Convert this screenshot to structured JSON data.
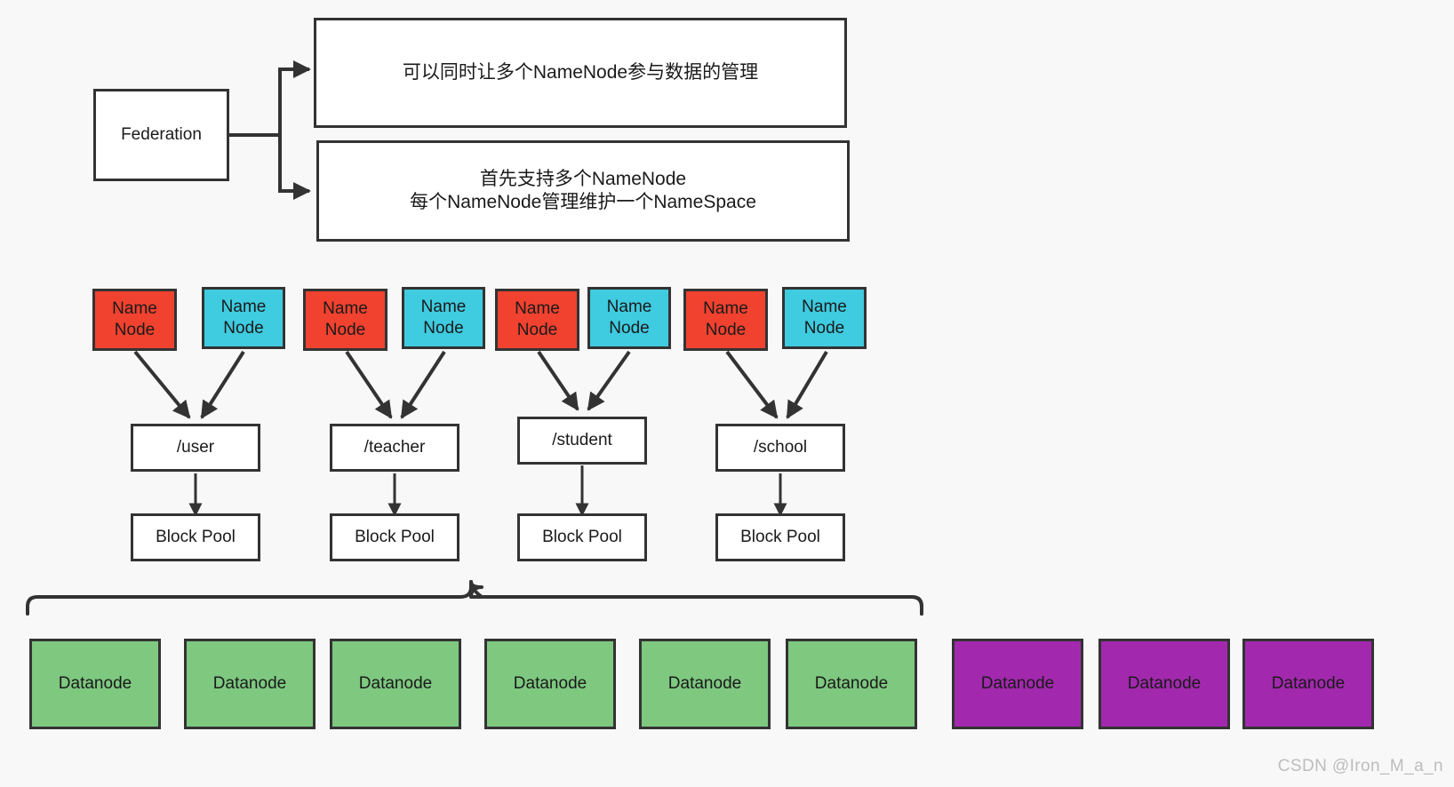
{
  "diagram": {
    "title_box": {
      "label": "Federation"
    },
    "info_boxes": [
      {
        "label": "可以同时让多个NameNode参与数据的管理"
      },
      {
        "label": "首先支持多个NameNode\n每个NameNode管理维护一个NameSpace"
      }
    ],
    "namenodes": [
      {
        "label": "Name\nNode",
        "color": "#f0422f",
        "kind": "red"
      },
      {
        "label": "Name\nNode",
        "color": "#3fcbe0",
        "kind": "cyan"
      },
      {
        "label": "Name\nNode",
        "color": "#f0422f",
        "kind": "red"
      },
      {
        "label": "Name\nNode",
        "color": "#3fcbe0",
        "kind": "cyan"
      },
      {
        "label": "Name\nNode",
        "color": "#f0422f",
        "kind": "red"
      },
      {
        "label": "Name\nNode",
        "color": "#3fcbe0",
        "kind": "cyan"
      },
      {
        "label": "Name\nNode",
        "color": "#f0422f",
        "kind": "red"
      },
      {
        "label": "Name\nNode",
        "color": "#3fcbe0",
        "kind": "cyan"
      }
    ],
    "namespaces": [
      {
        "label": "/user"
      },
      {
        "label": "/teacher"
      },
      {
        "label": "/student"
      },
      {
        "label": "/school"
      }
    ],
    "block_pools": [
      {
        "label": "Block Pool"
      },
      {
        "label": "Block Pool"
      },
      {
        "label": "Block Pool"
      },
      {
        "label": "Block Pool"
      }
    ],
    "datanodes_green": [
      {
        "label": "Datanode",
        "color": "#7ec880"
      },
      {
        "label": "Datanode",
        "color": "#7ec880"
      },
      {
        "label": "Datanode",
        "color": "#7ec880"
      },
      {
        "label": "Datanode",
        "color": "#7ec880"
      },
      {
        "label": "Datanode",
        "color": "#7ec880"
      },
      {
        "label": "Datanode",
        "color": "#7ec880"
      }
    ],
    "datanodes_purple": [
      {
        "label": "Datanode",
        "color": "#a229ad"
      },
      {
        "label": "Datanode",
        "color": "#a229ad"
      },
      {
        "label": "Datanode",
        "color": "#a229ad"
      }
    ],
    "watermark": "CSDN @Iron_M_a_n",
    "colors": {
      "background": "#f8f8f8",
      "stroke": "#333333",
      "box_fill": "#ffffff",
      "namenode_red": "#f0422f",
      "namenode_cyan": "#3fcbe0",
      "datanode_green": "#7ec880",
      "datanode_purple": "#a229ad",
      "watermark": "#bdbdbd"
    }
  }
}
